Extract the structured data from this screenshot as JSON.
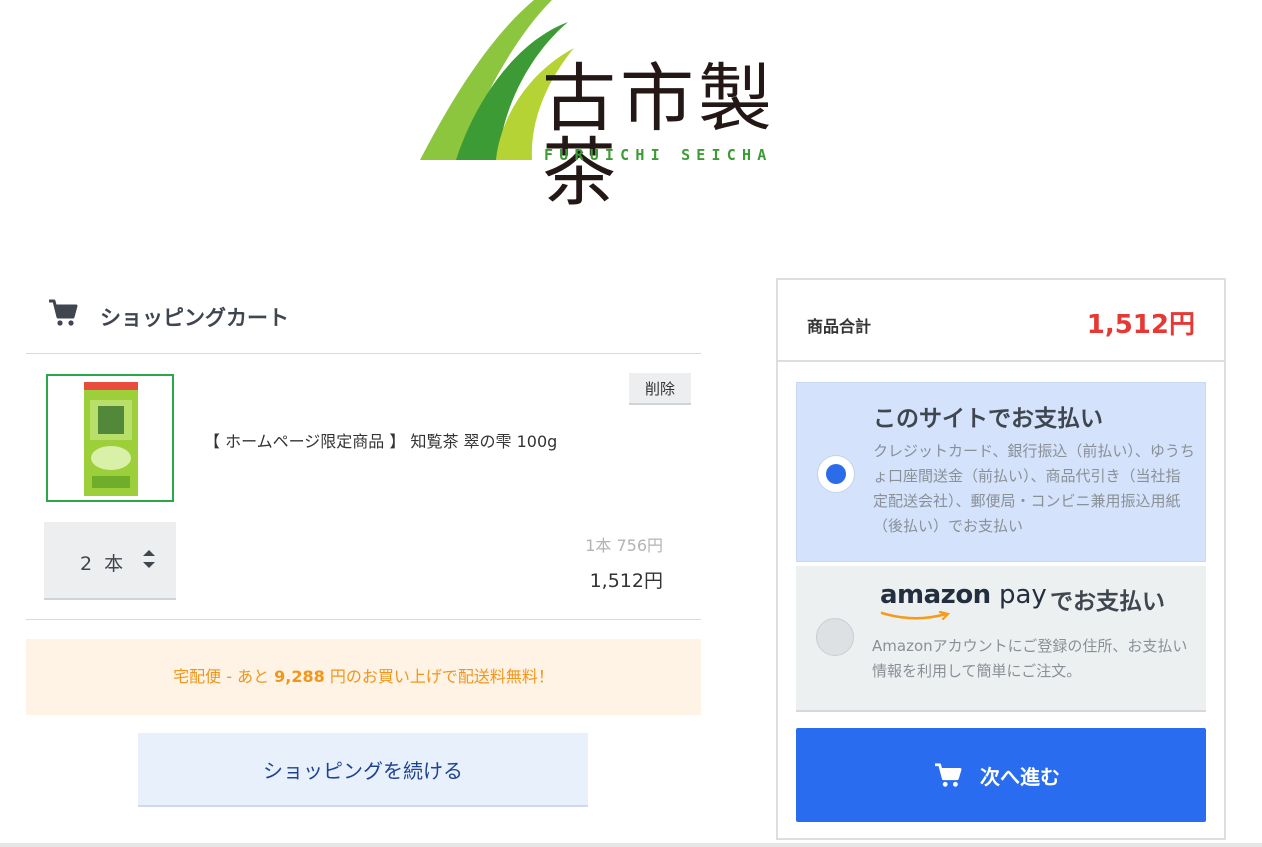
{
  "brand": {
    "name_jp": "古市製茶",
    "name_en": "FURUICHI SEICHA",
    "colors": {
      "leaf_light": "#9bcf2e",
      "leaf_dark": "#3d9b35"
    }
  },
  "cart": {
    "icon": "shopping-cart-icon",
    "title": "ショッピングカート",
    "items": [
      {
        "name": "【 ホームページ限定商品 】 知覧茶 翠の雫 100g",
        "delete_label": "削除",
        "quantity": "2 本",
        "unit_price": "1本 756円",
        "line_total": "1,512円"
      }
    ],
    "shipping_notice": {
      "prefix": "宅配便 - あと ",
      "amount": "9,288",
      "suffix": " 円のお買い上げで配送料無料！"
    },
    "continue_label": "ショッピングを続ける"
  },
  "summary": {
    "subtotal_label": "商品合計",
    "subtotal_value": "1,512円",
    "payment_options": [
      {
        "title": "このサイトでお支払い",
        "description": "クレジットカード、銀行振込（前払い）、ゆうちょ口座間送金（前払い）、商品代引き（当社指定配送会社）、郵便局・コンビニ兼用振込用紙（後払い）でお支払い",
        "selected": true
      },
      {
        "logo_text_1": "amazon",
        "logo_text_2": "pay",
        "title_suffix": "でお支払い",
        "description": "Amazonアカウントにご登録の住所、お支払い情報を利用して簡単にご注文。",
        "selected": false
      }
    ],
    "next_label": "次へ進む",
    "colors": {
      "total": "#e53935",
      "primary": "#2a6cef",
      "selected_bg": "#d4e2fb"
    }
  }
}
